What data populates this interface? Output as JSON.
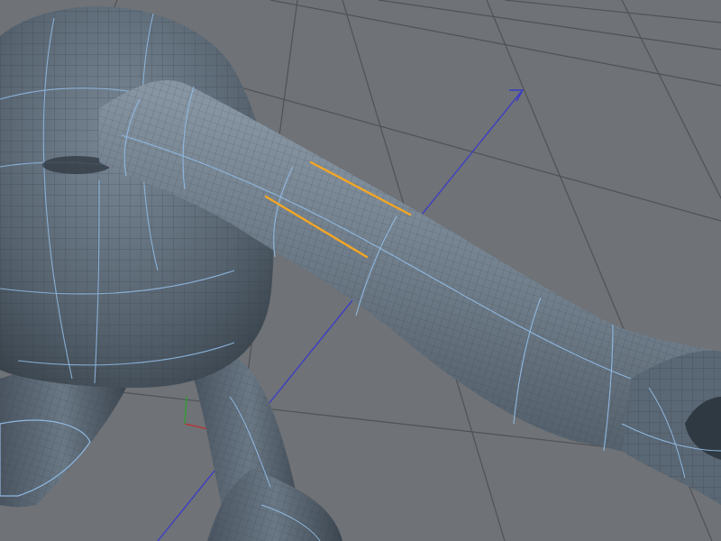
{
  "viewport": {
    "background_color": "#6f7276",
    "grid_color": "#4f5256",
    "mesh_color": "#5b6a78",
    "wire_color": "#2f3a44",
    "edge_loop_color": "#8fb8e0",
    "selection_color": "#f5a623",
    "axis_colors": {
      "x": "#c03030",
      "y": "#30a030",
      "z": "#3a3ac8"
    },
    "axis_icon": "arrow-icon",
    "selected_edges": 2
  }
}
